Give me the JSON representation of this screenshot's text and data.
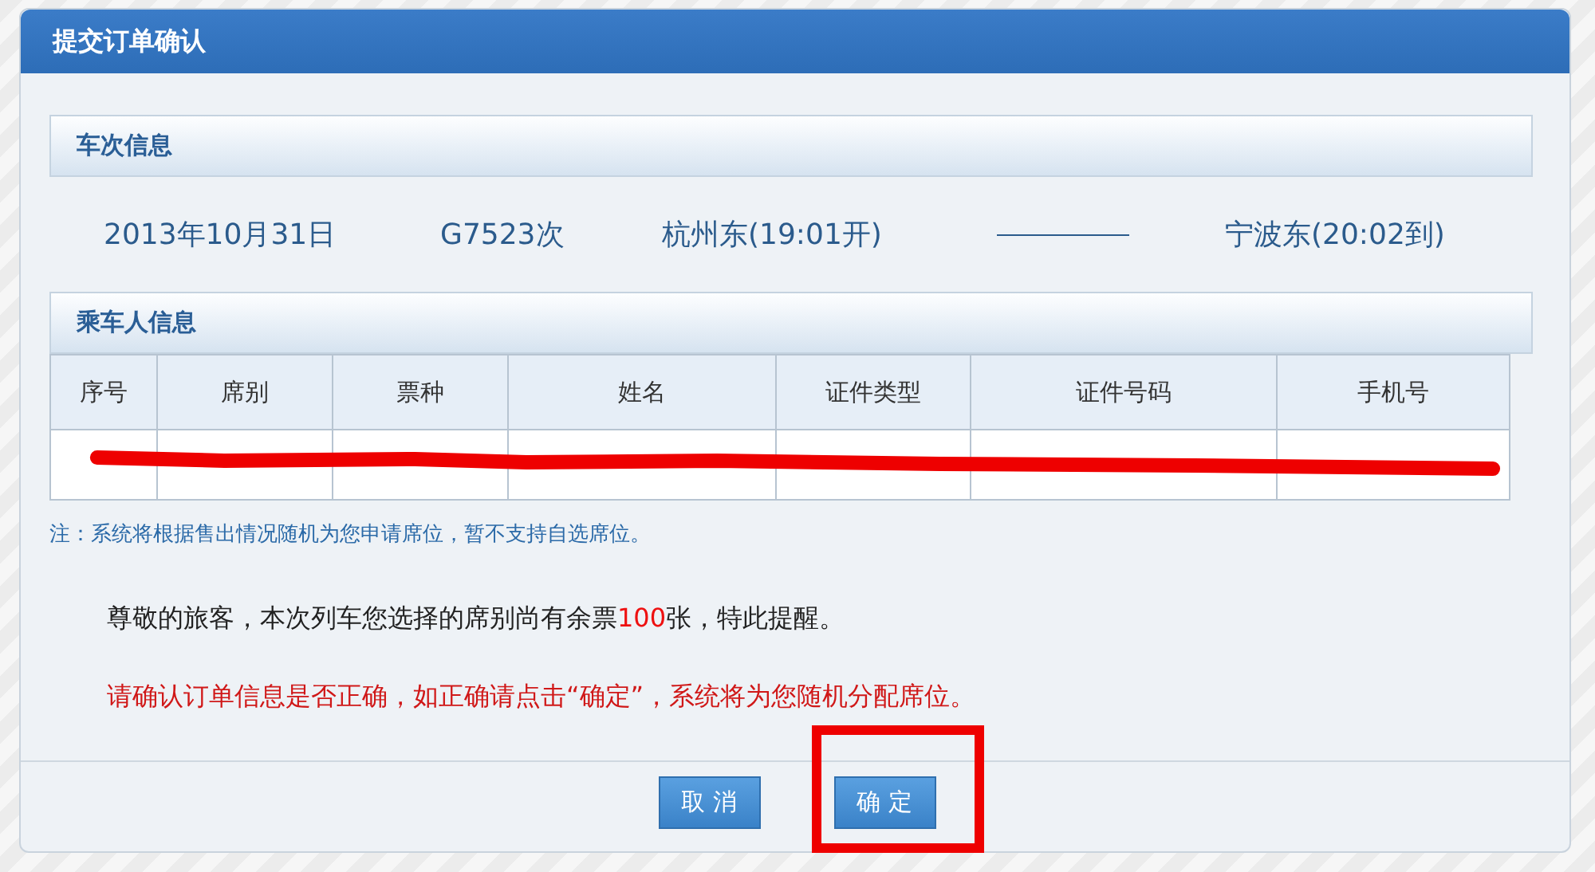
{
  "dialog": {
    "title": "提交订单确认"
  },
  "train_section": {
    "title": "车次信息",
    "date": "2013年10月31日",
    "train_no": "G7523次",
    "departure": "杭州东(19:01开)",
    "arrival": "宁波东(20:02到)"
  },
  "passenger_section": {
    "title": "乘车人信息",
    "columns": [
      "序号",
      "席别",
      "票种",
      "姓名",
      "证件类型",
      "证件号码",
      "手机号"
    ],
    "rows_redacted": true,
    "note": "注：系统将根据售出情况随机为您申请席位，暂不支持自选席位。"
  },
  "reminder": [
    {
      "text": "尊敬的旅客，本次列车您选择的席别尚有余票",
      "highlight": false
    },
    {
      "text": "100",
      "highlight": true
    },
    {
      "text": "张，特此提醒。",
      "highlight": false
    }
  ],
  "warning": "请确认订单信息是否正确，如正确请点击“确定”，系统将为您随机分配席位。",
  "buttons": [
    {
      "label": "取 消",
      "annotated": false
    },
    {
      "label": "确 定",
      "annotated": true
    }
  ]
}
